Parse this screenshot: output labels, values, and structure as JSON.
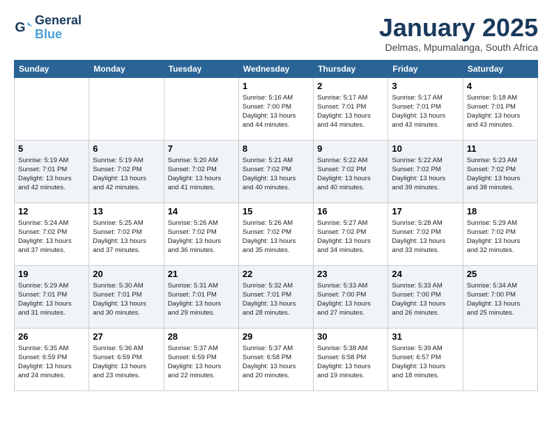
{
  "header": {
    "logo_line1": "General",
    "logo_line2": "Blue",
    "month": "January 2025",
    "location": "Delmas, Mpumalanga, South Africa"
  },
  "weekdays": [
    "Sunday",
    "Monday",
    "Tuesday",
    "Wednesday",
    "Thursday",
    "Friday",
    "Saturday"
  ],
  "weeks": [
    [
      {
        "day": "",
        "info": ""
      },
      {
        "day": "",
        "info": ""
      },
      {
        "day": "",
        "info": ""
      },
      {
        "day": "1",
        "info": "Sunrise: 5:16 AM\nSunset: 7:00 PM\nDaylight: 13 hours\nand 44 minutes."
      },
      {
        "day": "2",
        "info": "Sunrise: 5:17 AM\nSunset: 7:01 PM\nDaylight: 13 hours\nand 44 minutes."
      },
      {
        "day": "3",
        "info": "Sunrise: 5:17 AM\nSunset: 7:01 PM\nDaylight: 13 hours\nand 43 minutes."
      },
      {
        "day": "4",
        "info": "Sunrise: 5:18 AM\nSunset: 7:01 PM\nDaylight: 13 hours\nand 43 minutes."
      }
    ],
    [
      {
        "day": "5",
        "info": "Sunrise: 5:19 AM\nSunset: 7:01 PM\nDaylight: 13 hours\nand 42 minutes."
      },
      {
        "day": "6",
        "info": "Sunrise: 5:19 AM\nSunset: 7:02 PM\nDaylight: 13 hours\nand 42 minutes."
      },
      {
        "day": "7",
        "info": "Sunrise: 5:20 AM\nSunset: 7:02 PM\nDaylight: 13 hours\nand 41 minutes."
      },
      {
        "day": "8",
        "info": "Sunrise: 5:21 AM\nSunset: 7:02 PM\nDaylight: 13 hours\nand 40 minutes."
      },
      {
        "day": "9",
        "info": "Sunrise: 5:22 AM\nSunset: 7:02 PM\nDaylight: 13 hours\nand 40 minutes."
      },
      {
        "day": "10",
        "info": "Sunrise: 5:22 AM\nSunset: 7:02 PM\nDaylight: 13 hours\nand 39 minutes."
      },
      {
        "day": "11",
        "info": "Sunrise: 5:23 AM\nSunset: 7:02 PM\nDaylight: 13 hours\nand 38 minutes."
      }
    ],
    [
      {
        "day": "12",
        "info": "Sunrise: 5:24 AM\nSunset: 7:02 PM\nDaylight: 13 hours\nand 37 minutes."
      },
      {
        "day": "13",
        "info": "Sunrise: 5:25 AM\nSunset: 7:02 PM\nDaylight: 13 hours\nand 37 minutes."
      },
      {
        "day": "14",
        "info": "Sunrise: 5:26 AM\nSunset: 7:02 PM\nDaylight: 13 hours\nand 36 minutes."
      },
      {
        "day": "15",
        "info": "Sunrise: 5:26 AM\nSunset: 7:02 PM\nDaylight: 13 hours\nand 35 minutes."
      },
      {
        "day": "16",
        "info": "Sunrise: 5:27 AM\nSunset: 7:02 PM\nDaylight: 13 hours\nand 34 minutes."
      },
      {
        "day": "17",
        "info": "Sunrise: 5:28 AM\nSunset: 7:02 PM\nDaylight: 13 hours\nand 33 minutes."
      },
      {
        "day": "18",
        "info": "Sunrise: 5:29 AM\nSunset: 7:02 PM\nDaylight: 13 hours\nand 32 minutes."
      }
    ],
    [
      {
        "day": "19",
        "info": "Sunrise: 5:29 AM\nSunset: 7:01 PM\nDaylight: 13 hours\nand 31 minutes."
      },
      {
        "day": "20",
        "info": "Sunrise: 5:30 AM\nSunset: 7:01 PM\nDaylight: 13 hours\nand 30 minutes."
      },
      {
        "day": "21",
        "info": "Sunrise: 5:31 AM\nSunset: 7:01 PM\nDaylight: 13 hours\nand 29 minutes."
      },
      {
        "day": "22",
        "info": "Sunrise: 5:32 AM\nSunset: 7:01 PM\nDaylight: 13 hours\nand 28 minutes."
      },
      {
        "day": "23",
        "info": "Sunrise: 5:33 AM\nSunset: 7:00 PM\nDaylight: 13 hours\nand 27 minutes."
      },
      {
        "day": "24",
        "info": "Sunrise: 5:33 AM\nSunset: 7:00 PM\nDaylight: 13 hours\nand 26 minutes."
      },
      {
        "day": "25",
        "info": "Sunrise: 5:34 AM\nSunset: 7:00 PM\nDaylight: 13 hours\nand 25 minutes."
      }
    ],
    [
      {
        "day": "26",
        "info": "Sunrise: 5:35 AM\nSunset: 6:59 PM\nDaylight: 13 hours\nand 24 minutes."
      },
      {
        "day": "27",
        "info": "Sunrise: 5:36 AM\nSunset: 6:59 PM\nDaylight: 13 hours\nand 23 minutes."
      },
      {
        "day": "28",
        "info": "Sunrise: 5:37 AM\nSunset: 6:59 PM\nDaylight: 13 hours\nand 22 minutes."
      },
      {
        "day": "29",
        "info": "Sunrise: 5:37 AM\nSunset: 6:58 PM\nDaylight: 13 hours\nand 20 minutes."
      },
      {
        "day": "30",
        "info": "Sunrise: 5:38 AM\nSunset: 6:58 PM\nDaylight: 13 hours\nand 19 minutes."
      },
      {
        "day": "31",
        "info": "Sunrise: 5:39 AM\nSunset: 6:57 PM\nDaylight: 13 hours\nand 18 minutes."
      },
      {
        "day": "",
        "info": ""
      }
    ]
  ]
}
